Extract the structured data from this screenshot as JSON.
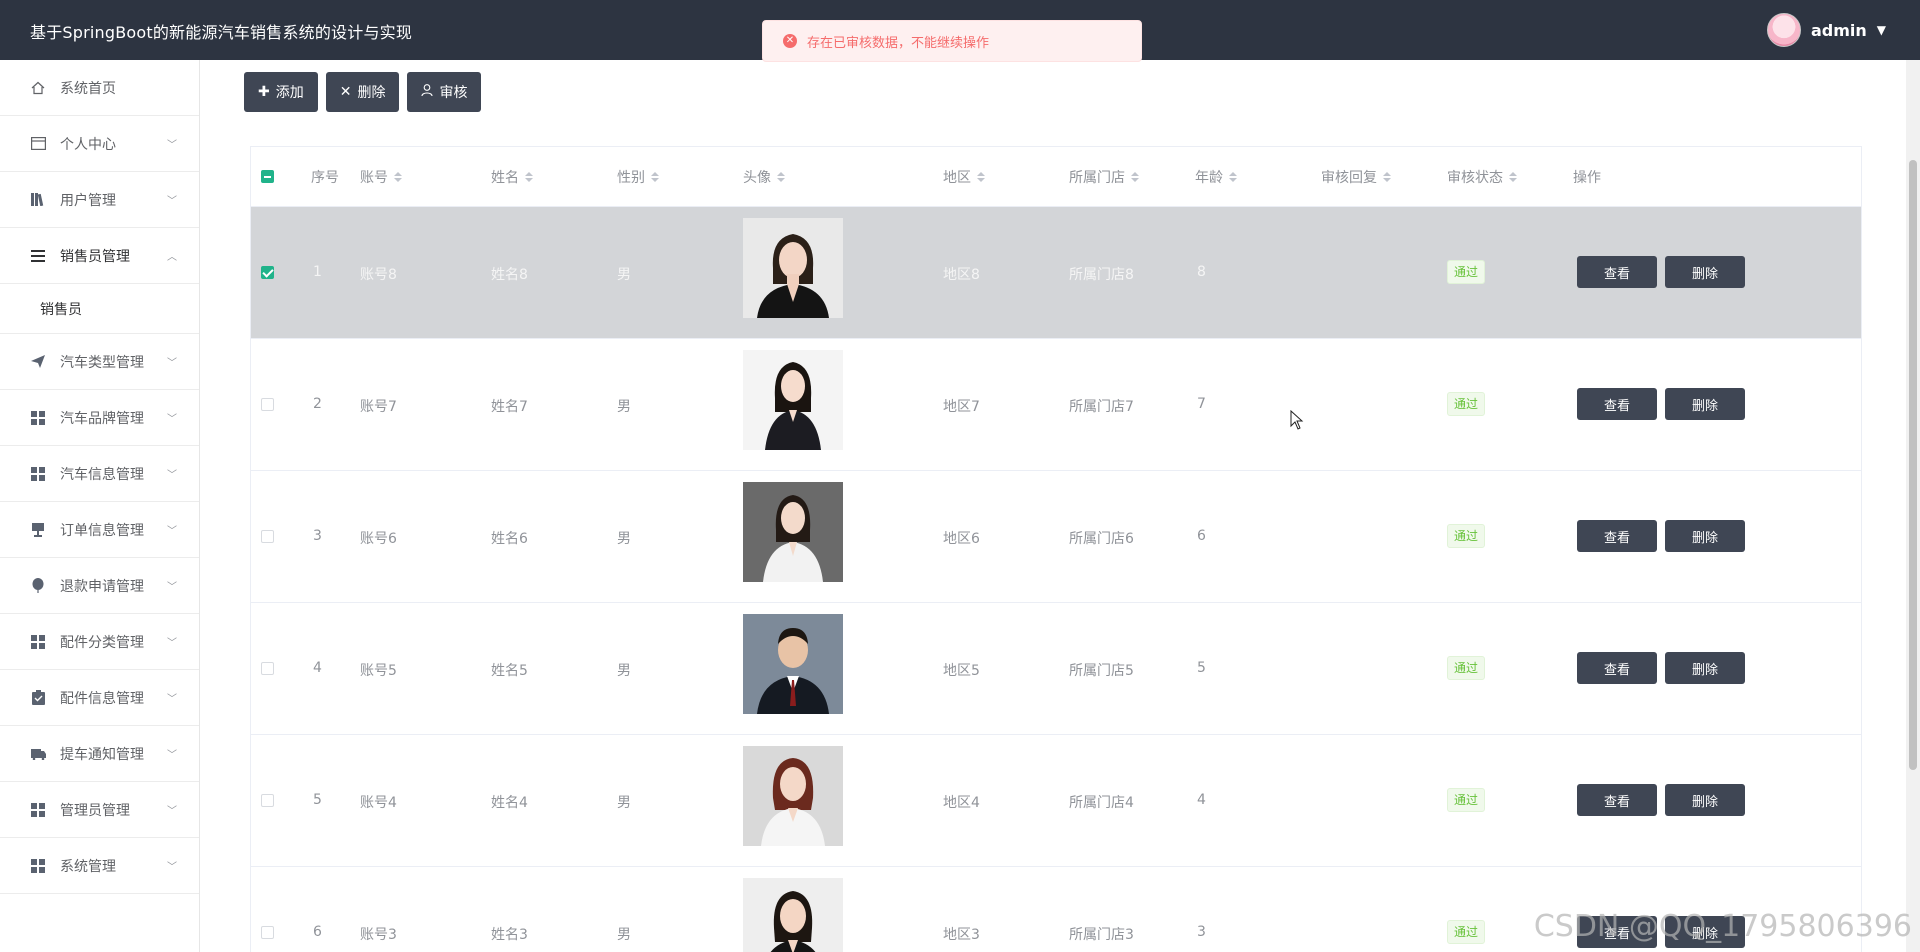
{
  "header": {
    "title": "基于SpringBoot的新能源汽车销售系统的设计与实现",
    "username": "admin"
  },
  "toast": {
    "message": "存在已审核数据，不能继续操作",
    "icon": "error-circle-icon",
    "color": "#f56c6c"
  },
  "sidebar": {
    "items": [
      {
        "label": "系统首页",
        "icon": "home-icon",
        "arrow": false
      },
      {
        "label": "个人中心",
        "icon": "card-icon",
        "arrow": true
      },
      {
        "label": "用户管理",
        "icon": "books-icon",
        "arrow": true
      },
      {
        "label": "销售员管理",
        "icon": "list-icon",
        "arrow": true,
        "open": true
      },
      {
        "label": "汽车类型管理",
        "icon": "send-icon",
        "arrow": true
      },
      {
        "label": "汽车品牌管理",
        "icon": "grid-icon",
        "arrow": true
      },
      {
        "label": "汽车信息管理",
        "icon": "grid-icon",
        "arrow": true
      },
      {
        "label": "订单信息管理",
        "icon": "monitor-icon",
        "arrow": true
      },
      {
        "label": "退款申请管理",
        "icon": "balloon-icon",
        "arrow": true
      },
      {
        "label": "配件分类管理",
        "icon": "grid-icon",
        "arrow": true
      },
      {
        "label": "配件信息管理",
        "icon": "clipboard-icon",
        "arrow": true
      },
      {
        "label": "提车通知管理",
        "icon": "bus-icon",
        "arrow": true
      },
      {
        "label": "管理员管理",
        "icon": "grid-icon",
        "arrow": true
      },
      {
        "label": "系统管理",
        "icon": "grid-icon",
        "arrow": true
      }
    ],
    "submenu_label": "销售员"
  },
  "toolbar": {
    "add_label": "添加",
    "delete_label": "删除",
    "audit_label": "审核"
  },
  "table": {
    "headers": {
      "index": "序号",
      "account": "账号",
      "name": "姓名",
      "gender": "性别",
      "photo": "头像",
      "region": "地区",
      "store": "所属门店",
      "age": "年龄",
      "reply": "审核回复",
      "status": "审核状态",
      "ops": "操作"
    },
    "rows": [
      {
        "index": "1",
        "account": "账号8",
        "name": "姓名8",
        "gender": "男",
        "region": "地区8",
        "store": "所属门店8",
        "age": "8",
        "status": "通过",
        "selected": true
      },
      {
        "index": "2",
        "account": "账号7",
        "name": "姓名7",
        "gender": "男",
        "region": "地区7",
        "store": "所属门店7",
        "age": "7",
        "status": "通过",
        "selected": false
      },
      {
        "index": "3",
        "account": "账号6",
        "name": "姓名6",
        "gender": "男",
        "region": "地区6",
        "store": "所属门店6",
        "age": "6",
        "status": "通过",
        "selected": false
      },
      {
        "index": "4",
        "account": "账号5",
        "name": "姓名5",
        "gender": "男",
        "region": "地区5",
        "store": "所属门店5",
        "age": "5",
        "status": "通过",
        "selected": false
      },
      {
        "index": "5",
        "account": "账号4",
        "name": "姓名4",
        "gender": "男",
        "region": "地区4",
        "store": "所属门店4",
        "age": "4",
        "status": "通过",
        "selected": false
      },
      {
        "index": "6",
        "account": "账号3",
        "name": "姓名3",
        "gender": "男",
        "region": "地区3",
        "store": "所属门店3",
        "age": "3",
        "status": "通过",
        "selected": false
      }
    ],
    "view_label": "查看",
    "delete_label": "删除"
  },
  "watermark": "CSDN @QQ_1795806396",
  "colors": {
    "topbar": "#2d3441",
    "button": "#3f4654",
    "checkbox": "#20b38a",
    "tag_green": "#67c23a",
    "selected_row": "#d3d5d8"
  }
}
